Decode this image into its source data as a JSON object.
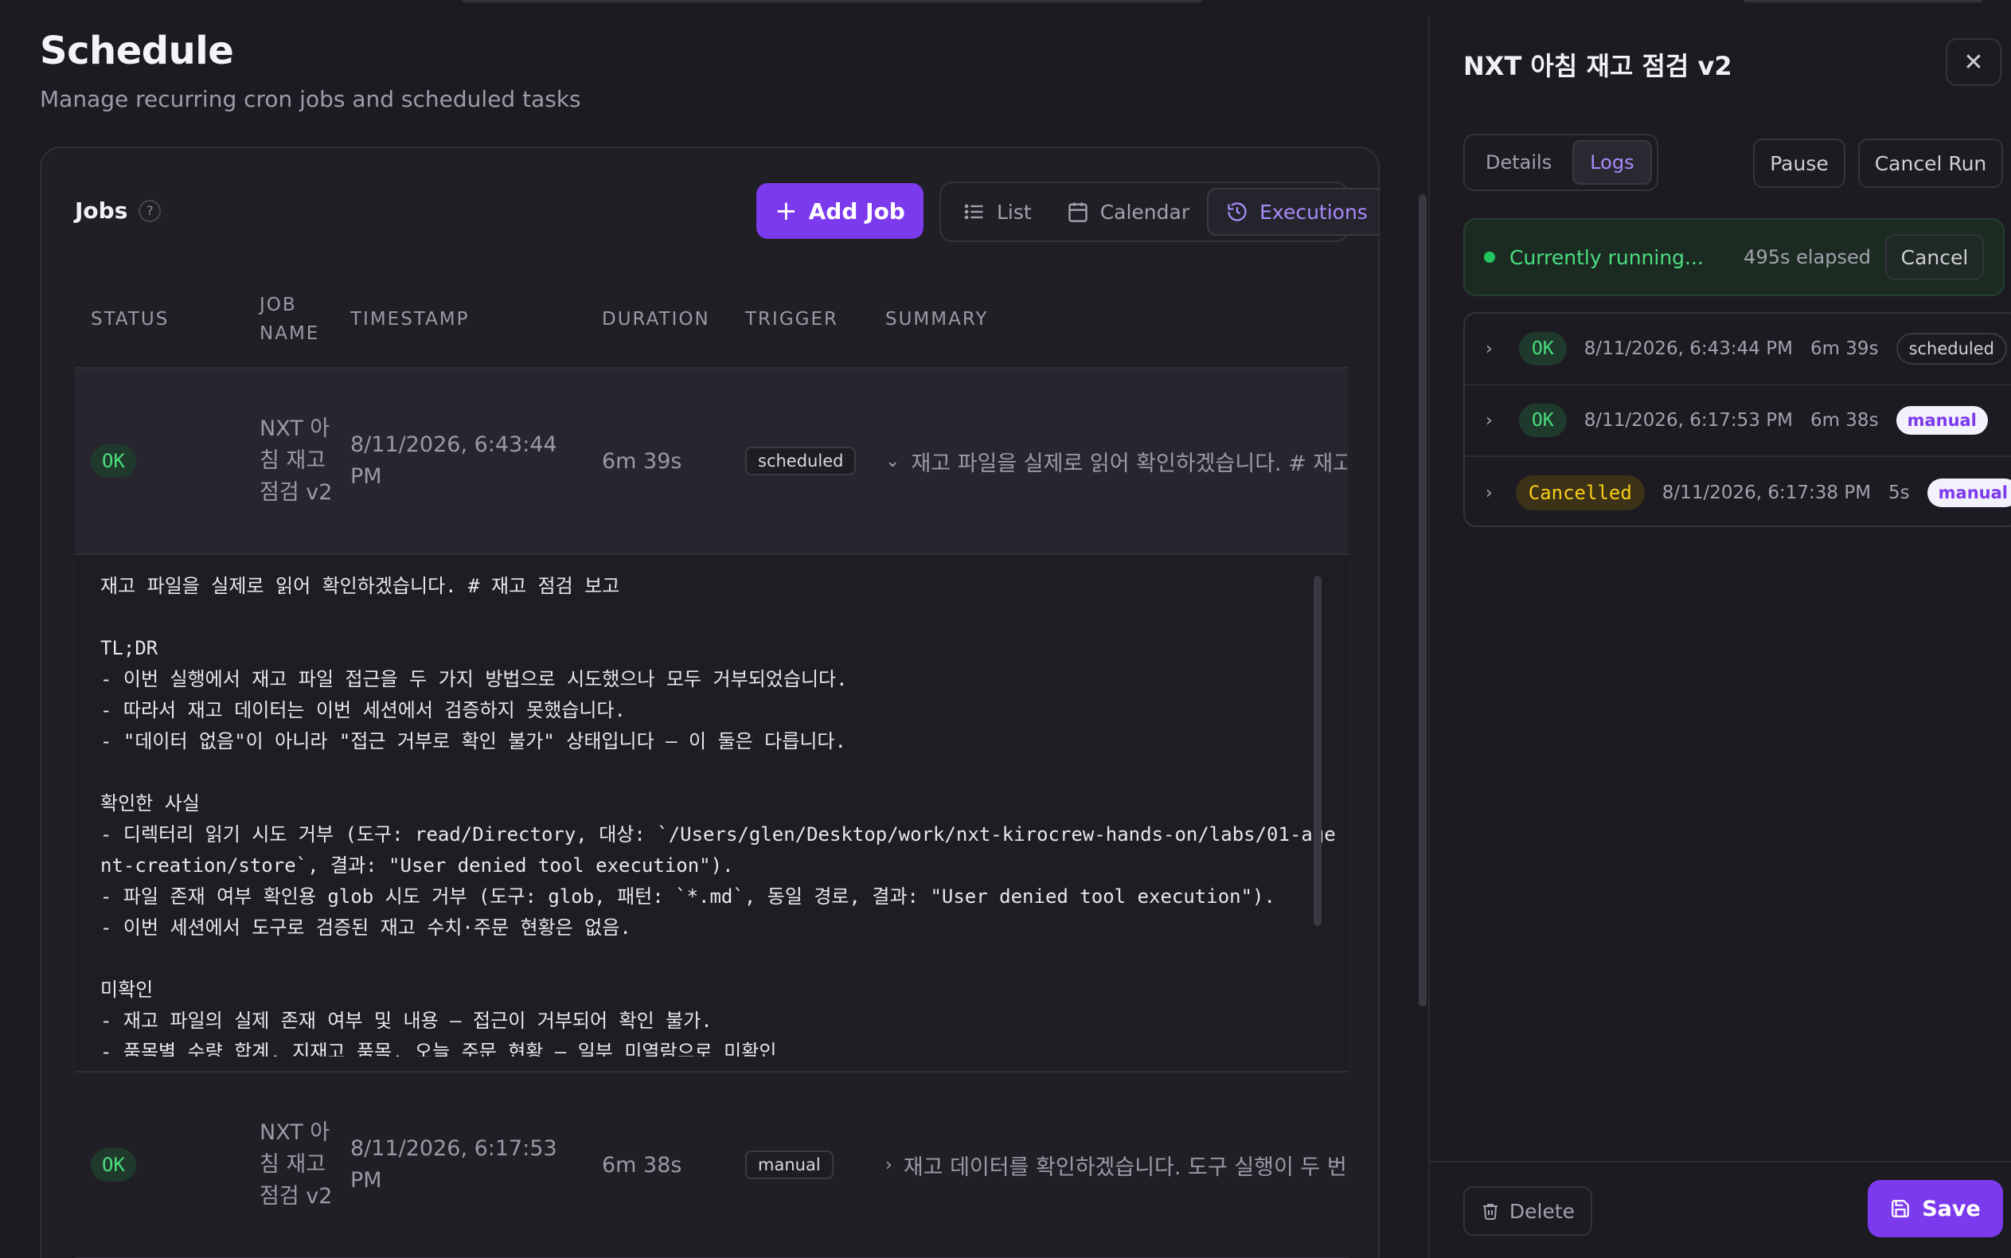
{
  "header": {
    "title": "Schedule",
    "subtitle": "Manage recurring cron jobs and scheduled tasks"
  },
  "jobs": {
    "title": "Jobs",
    "help": "?",
    "add_label": "Add Job",
    "views": [
      "List",
      "Calendar",
      "Executions"
    ],
    "active_view": "Executions"
  },
  "table": {
    "columns": [
      "STATUS",
      "JOB NAME",
      "TIMESTAMP",
      "DURATION",
      "TRIGGER",
      "SUMMARY"
    ],
    "rows": [
      {
        "status": "OK",
        "job_name": "NXT 아침 재고 점검 v2",
        "timestamp": "8/11/2026, 6:43:44 PM",
        "duration": "6m 39s",
        "trigger": "scheduled",
        "summary": "재고 파일을 실제로 읽어 확인하겠습니다. # 재고 점검 보고",
        "expanded": true
      },
      {
        "status": "OK",
        "job_name": "NXT 아침 재고 점검 v2",
        "timestamp": "8/11/2026, 6:17:53 PM",
        "duration": "6m 38s",
        "trigger": "manual",
        "summary": "재고 데이터를 확인하겠습니다. 도구 실행이 두 번 거부되었습니다.",
        "expanded": false
      }
    ],
    "expanded_text": "재고 파일을 실제로 읽어 확인하겠습니다. # 재고 점검 보고\n\nTL;DR\n- 이번 실행에서 재고 파일 접근을 두 가지 방법으로 시도했으나 모두 거부되었습니다.\n- 따라서 재고 데이터는 이번 세션에서 검증하지 못했습니다.\n- \"데이터 없음\"이 아니라 \"접근 거부로 확인 불가\" 상태입니다 — 이 둘은 다릅니다.\n\n확인한 사실\n- 디렉터리 읽기 시도 거부 (도구: read/Directory, 대상: `/Users/glen/Desktop/work/nxt-kirocrew-hands-on/labs/01-agent-creation/store`, 결과: \"User denied tool execution\").\n- 파일 존재 여부 확인용 glob 시도 거부 (도구: glob, 패턴: `*.md`, 동일 경로, 결과: \"User denied tool execution\").\n- 이번 세션에서 도구로 검증된 재고 수치·주문 현황은 없음.\n\n미확인\n- 재고 파일의 실제 존재 여부 및 내용 — 접근이 거부되어 확인 불가.\n- 품목별 수량 합계, 지재고 품목, 오늘 주문 현황 — 일부 미열람으로 미확인"
  },
  "panel": {
    "title": "NXT 아침 재고 점검 v2",
    "tabs": [
      "Details",
      "Logs"
    ],
    "active_tab": "Logs",
    "pause_label": "Pause",
    "cancel_run_label": "Cancel Run",
    "running": {
      "text": "Currently running...",
      "elapsed": "495s elapsed",
      "cancel_label": "Cancel"
    },
    "runs": [
      {
        "status": "OK",
        "timestamp": "8/11/2026, 6:43:44 PM",
        "duration": "6m 39s",
        "trigger": "scheduled"
      },
      {
        "status": "OK",
        "timestamp": "8/11/2026, 6:17:53 PM",
        "duration": "6m 38s",
        "trigger": "manual"
      },
      {
        "status": "Cancelled",
        "timestamp": "8/11/2026, 6:17:38 PM",
        "duration": "5s",
        "trigger": "manual"
      }
    ],
    "delete_label": "Delete",
    "save_label": "Save"
  },
  "colors": {
    "accent": "#7c3aed",
    "accent_text": "#a78bfa",
    "ok": "#4ade80",
    "cancelled": "#facc15",
    "background": "#1c1b22"
  }
}
